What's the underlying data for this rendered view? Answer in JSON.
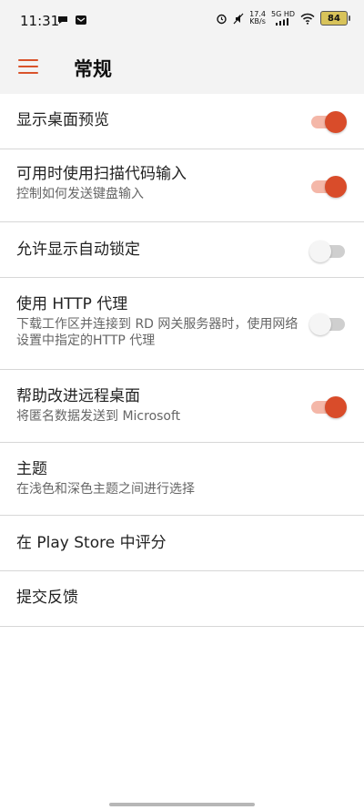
{
  "status": {
    "time": "11:31",
    "network_speed": "17.4",
    "network_unit": "KB/s",
    "network_mode": "5G HD",
    "battery": "84"
  },
  "appbar": {
    "title": "常规",
    "accent": "#d9532b"
  },
  "settings": {
    "items": [
      {
        "title": "显示桌面预览",
        "desc": "",
        "toggle": "on"
      },
      {
        "title": "可用时使用扫描代码输入",
        "desc": "控制如何发送键盘输入",
        "toggle": "on"
      },
      {
        "title": "允许显示自动锁定",
        "desc": "",
        "toggle": "off"
      },
      {
        "title": "使用 HTTP 代理",
        "desc": "下载工作区并连接到 RD 网关服务器时，使用网络设置中指定的HTTP 代理",
        "toggle": "off"
      },
      {
        "title": "帮助改进远程桌面",
        "desc": "将匿名数据发送到 Microsoft",
        "toggle": "on"
      },
      {
        "title": "主题",
        "desc": "在浅色和深色主题之间进行选择"
      },
      {
        "title": "在 Play Store 中评分",
        "desc": ""
      },
      {
        "title": "提交反馈",
        "desc": ""
      }
    ]
  }
}
